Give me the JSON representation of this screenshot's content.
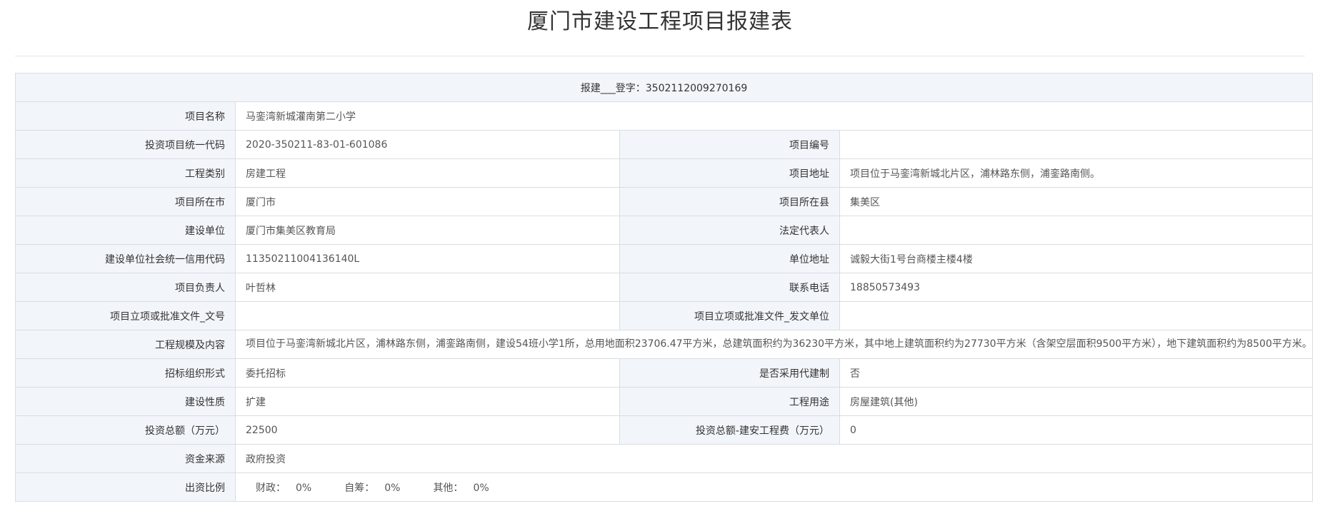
{
  "page": {
    "title": "厦门市建设工程项目报建表"
  },
  "header": {
    "text": "报建___登字：3502112009270169"
  },
  "rows": {
    "project_name": {
      "label": "项目名称",
      "value": "马銮湾新城灌南第二小学"
    },
    "invest_code": {
      "label": "投资项目统一代码",
      "value": "2020-350211-83-01-601086"
    },
    "project_no": {
      "label": "项目编号",
      "value": ""
    },
    "eng_type": {
      "label": "工程类别",
      "value": "房建工程"
    },
    "address": {
      "label": "项目地址",
      "value": "项目位于马銮湾新城北片区，浦林路东侧，浦銮路南侧。"
    },
    "city": {
      "label": "项目所在市",
      "value": "厦门市"
    },
    "county": {
      "label": "项目所在县",
      "value": "集美区"
    },
    "builder": {
      "label": "建设单位",
      "value": "厦门市集美区教育局"
    },
    "legal_rep": {
      "label": "法定代表人",
      "value": ""
    },
    "credit_code": {
      "label": "建设单位社会统一信用代码",
      "value": "11350211004136140L"
    },
    "unit_address": {
      "label": "单位地址",
      "value": "诚毅大街1号台商楼主楼4楼"
    },
    "manager": {
      "label": "项目负责人",
      "value": "叶哲林"
    },
    "phone": {
      "label": "联系电话",
      "value": "18850573493"
    },
    "approval_doc": {
      "label": "项目立项或批准文件_文号",
      "value": ""
    },
    "approval_unit": {
      "label": "项目立项或批准文件_发文单位",
      "value": ""
    },
    "scope": {
      "label": "工程规模及内容",
      "value": "项目位于马銮湾新城北片区，浦林路东侧，浦銮路南侧，建设54班小学1所，总用地面积23706.47平方米，总建筑面积约为36230平方米，其中地上建筑面积约为27730平方米（含架空层面积9500平方米），地下建筑面积约为8500平方米。主要建设内容为普通教室、专业教室、行政用房、食堂、体育馆、地下一层停车场、室外活动场地及相关配套设施等。"
    },
    "tender_form": {
      "label": "招标组织形式",
      "value": "委托招标"
    },
    "agent_system": {
      "label": "是否采用代建制",
      "value": "否"
    },
    "nature": {
      "label": "建设性质",
      "value": "扩建"
    },
    "usage": {
      "label": "工程用途",
      "value": "房屋建筑(其他)"
    },
    "total_invest": {
      "label": "投资总额（万元）",
      "value": "22500"
    },
    "install_fee": {
      "label": "投资总额-建安工程费（万元）",
      "value": "0"
    },
    "fund_source": {
      "label": "资金来源",
      "value": "政府投资"
    },
    "ratio": {
      "label": "出资比例",
      "finance_label": "财政：",
      "finance_value": "0%",
      "self_label": "自筹：",
      "self_value": "0%",
      "other_label": "其他：",
      "other_value": "0%"
    }
  }
}
